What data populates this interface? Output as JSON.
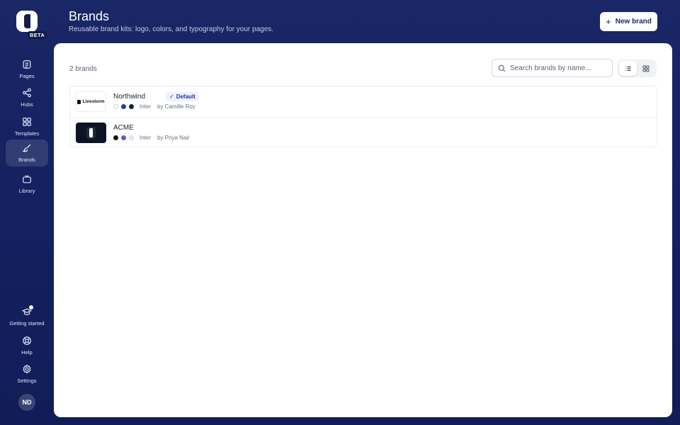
{
  "app": {
    "beta_label": "BETA"
  },
  "sidebar": {
    "items": [
      {
        "label": "Pages",
        "icon": "pages-icon"
      },
      {
        "label": "Hubs",
        "icon": "share-icon"
      },
      {
        "label": "Templates",
        "icon": "grid-icon"
      },
      {
        "label": "Brands",
        "icon": "brush-icon",
        "active": true
      },
      {
        "label": "Library",
        "icon": "tv-icon"
      }
    ],
    "bottom_items": [
      {
        "label": "Getting started",
        "icon": "graduation-cap-icon",
        "notification": true
      },
      {
        "label": "Help",
        "icon": "lifebuoy-icon"
      },
      {
        "label": "Settings",
        "icon": "gear-icon"
      }
    ],
    "avatar_initials": "ND"
  },
  "header": {
    "title": "Brands",
    "subtitle": "Reusable brand kits: logo, colors, and typography for your pages.",
    "new_button_label": "New brand"
  },
  "main": {
    "count_label": "2 brands",
    "search": {
      "placeholder": "Search brands by name...",
      "value": ""
    },
    "view_mode": "list",
    "brands": [
      {
        "name": "Northwind",
        "is_default": true,
        "default_label": "Default",
        "logo_text": "Livestorm",
        "colors": [
          "#ffffff",
          "#1a3fb0",
          "#0f2a2a"
        ],
        "font": "Inter",
        "author": "by Camille Roy"
      },
      {
        "name": "ACME",
        "is_default": false,
        "colors": [
          "#111111",
          "#7b4be0",
          "#ede9fb"
        ],
        "font": "Inter",
        "author": "by Priya Nair"
      }
    ]
  },
  "colors": {
    "sidebar_bg": "#1a2766",
    "accent": "#1c2869",
    "badge_bg": "#eef2ff"
  }
}
